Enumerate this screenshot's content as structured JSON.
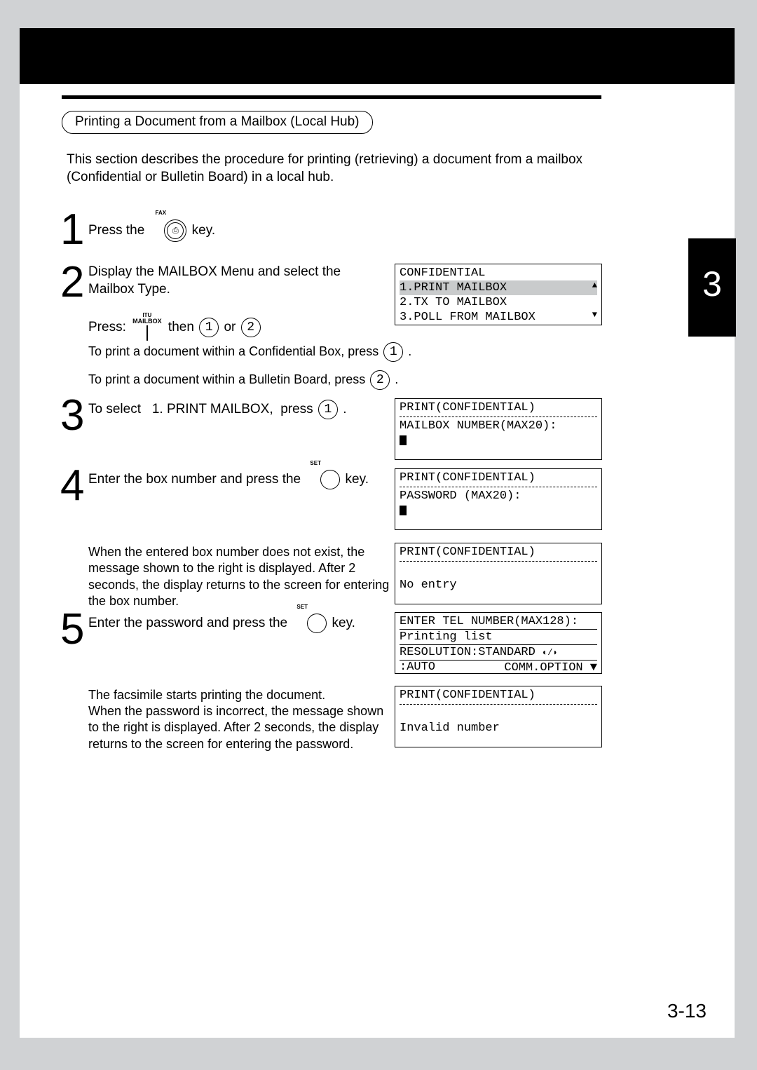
{
  "section_title": "Printing a Document from a Mailbox (Local Hub)",
  "intro": "This section describes the procedure for printing (retrieving) a document from a mailbox (Confidential or Bulletin Board) in a local hub.",
  "steps": {
    "s1": {
      "num": "1",
      "a": "Press the",
      "b": "key.",
      "fax_label": "FAX"
    },
    "s2": {
      "num": "2",
      "main": "Display the MAILBOX Menu and select the Mailbox Type.",
      "press": "Press:",
      "itu": "ITU",
      "mlb": "MAILBOX",
      "then": "then",
      "or": "or",
      "k1": "1",
      "k2": "2",
      "sub1a": "To print a document within a Confidential Box, press",
      "sub1k": "1",
      "sub1b": ".",
      "sub2a": "To print a document within a Bulletin Board, press",
      "sub2k": "2",
      "sub2b": "."
    },
    "s3": {
      "num": "3",
      "a": "To select",
      "b": "1. PRINT MAILBOX,",
      "c": "press",
      "k": "1",
      "d": "."
    },
    "s4": {
      "num": "4",
      "a": "Enter the box number and press the",
      "set": "SET",
      "b": "key.",
      "note": "When the entered box number does not exist, the message shown to the right is displayed.  After 2 seconds, the display returns to the screen for entering the box number."
    },
    "s5": {
      "num": "5",
      "a": "Enter the password and press the",
      "set": "SET",
      "b": "key.",
      "note1": "The facsimile starts printing the document.",
      "note2": "When the password is incorrect, the message shown to the right is displayed. After 2 seconds, the display returns to the screen for entering the password."
    }
  },
  "lcd2": {
    "l1": "CONFIDENTIAL",
    "l2": "1.PRINT MAILBOX",
    "l3": "2.TX TO MAILBOX",
    "l4": "3.POLL FROM MAILBOX"
  },
  "lcd3": {
    "l1": "PRINT(CONFIDENTIAL)",
    "l2": "MAILBOX NUMBER(MAX20):"
  },
  "lcd4a": {
    "l1": "PRINT(CONFIDENTIAL)",
    "l2": "PASSWORD (MAX20):"
  },
  "lcd4b": {
    "l1": "PRINT(CONFIDENTIAL)",
    "l2": "No entry"
  },
  "lcd5a": {
    "l1": "ENTER TEL NUMBER(MAX128):",
    "l2": "Printing list",
    "l3a": "RESOLUTION:STANDARD",
    "l3b": ":AUTO",
    "l4": "COMM.OPTION"
  },
  "lcd5b": {
    "l1": "PRINT(CONFIDENTIAL)",
    "l2": "Invalid number"
  },
  "chapter_tab": "3",
  "page_number": "3-13"
}
